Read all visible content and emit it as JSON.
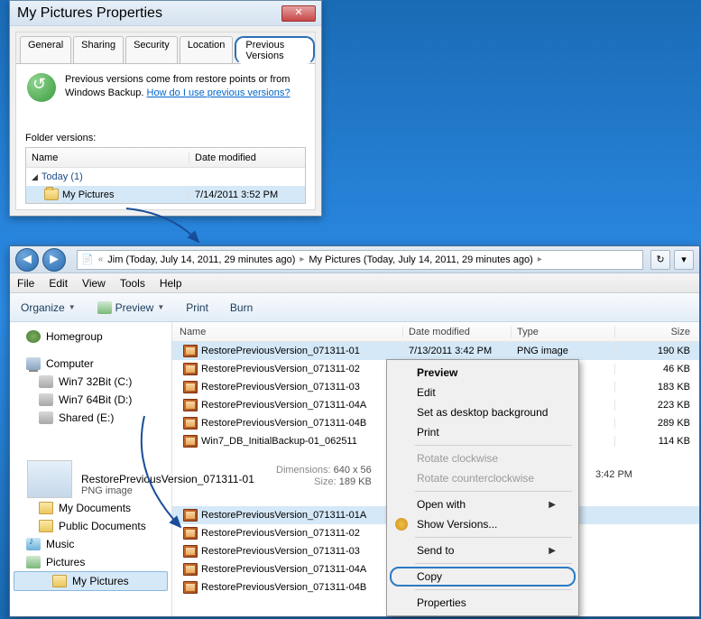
{
  "props": {
    "title": "My Pictures Properties",
    "tabs": [
      "General",
      "Sharing",
      "Security",
      "Location",
      "Previous Versions"
    ],
    "info_line1": "Previous versions come from restore points or from",
    "info_line2": "Windows Backup.",
    "info_link": "How do I use previous versions?",
    "folder_versions_label": "Folder versions:",
    "col_name": "Name",
    "col_date": "Date modified",
    "group_label": "Today (1)",
    "item_name": "My Pictures",
    "item_date": "7/14/2011 3:52 PM"
  },
  "explorer": {
    "breadcrumb": {
      "part1": "Jim (Today, July 14, 2011, 29 minutes ago)",
      "part2": "My Pictures (Today, July 14, 2011, 29 minutes ago)"
    },
    "menu": {
      "file": "File",
      "edit": "Edit",
      "view": "View",
      "tools": "Tools",
      "help": "Help"
    },
    "toolbar": {
      "organize": "Organize",
      "preview": "Preview",
      "print": "Print",
      "burn": "Burn"
    },
    "sidebar": {
      "homegroup": "Homegroup",
      "computer": "Computer",
      "drive1": "Win7 32Bit (C:)",
      "drive2": "Win7 64Bit (D:)",
      "drive3": "Shared (E:)",
      "mydocs": "My Documents",
      "pubdocs": "Public Documents",
      "music": "Music",
      "pictures": "Pictures",
      "mypics": "My Pictures"
    },
    "headers": {
      "name": "Name",
      "date": "Date modified",
      "type": "Type",
      "size": "Size"
    },
    "files_top": [
      {
        "name": "RestorePreviousVersion_071311-01",
        "date": "7/13/2011 3:42 PM",
        "type": "PNG image",
        "size": "190 KB"
      },
      {
        "name": "RestorePreviousVersion_071311-02",
        "date": "",
        "type": "",
        "size": "46 KB"
      },
      {
        "name": "RestorePreviousVersion_071311-03",
        "date": "",
        "type": "",
        "size": "183 KB"
      },
      {
        "name": "RestorePreviousVersion_071311-04A",
        "date": "",
        "type": "",
        "size": "223 KB"
      },
      {
        "name": "RestorePreviousVersion_071311-04B",
        "date": "",
        "type": "",
        "size": "289 KB"
      },
      {
        "name": "Win7_DB_InitialBackup-01_062511",
        "date": "",
        "type": "",
        "size": "114 KB"
      }
    ],
    "files_bottom": [
      {
        "name": "RestorePreviousVersion_071311-01A"
      },
      {
        "name": "RestorePreviousVersion_071311-02"
      },
      {
        "name": "RestorePreviousVersion_071311-03"
      },
      {
        "name": "RestorePreviousVersion_071311-04A"
      },
      {
        "name": "RestorePreviousVersion_071311-04B"
      }
    ],
    "details": {
      "name": "RestorePreviousVersion_071311-01",
      "type": "PNG image",
      "dim_label": "Dimensions:",
      "dim_value": "640 x 56",
      "size_label": "Size:",
      "size_value": "189 KB",
      "right_date": "3:42 PM"
    }
  },
  "ctx": {
    "preview": "Preview",
    "edit": "Edit",
    "set_bg": "Set as desktop background",
    "print": "Print",
    "rot_cw": "Rotate clockwise",
    "rot_ccw": "Rotate counterclockwise",
    "open_with": "Open with",
    "show_ver": "Show Versions...",
    "send_to": "Send to",
    "copy": "Copy",
    "properties": "Properties"
  }
}
